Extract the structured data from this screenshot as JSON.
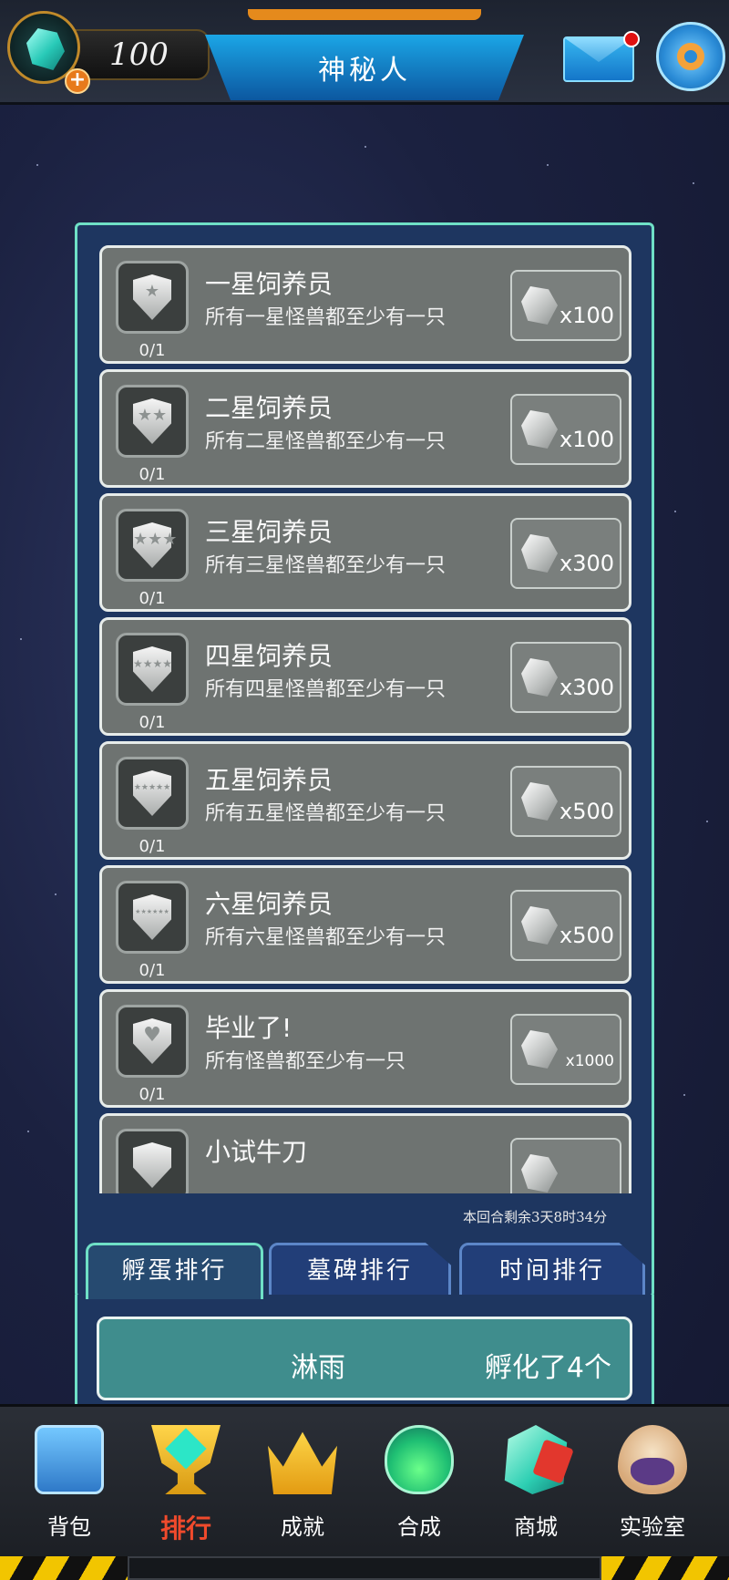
{
  "header": {
    "gem_count": "100",
    "title": "神秘人"
  },
  "achievements": [
    {
      "title": "一星饲养员",
      "desc": "所有一星怪兽都至少有一只",
      "progress": "0/1",
      "reward": "x100",
      "stars": "★"
    },
    {
      "title": "二星饲养员",
      "desc": "所有二星怪兽都至少有一只",
      "progress": "0/1",
      "reward": "x100",
      "stars": "★★"
    },
    {
      "title": "三星饲养员",
      "desc": "所有三星怪兽都至少有一只",
      "progress": "0/1",
      "reward": "x300",
      "stars": "★★★"
    },
    {
      "title": "四星饲养员",
      "desc": "所有四星怪兽都至少有一只",
      "progress": "0/1",
      "reward": "x300",
      "stars": "★★★★"
    },
    {
      "title": "五星饲养员",
      "desc": "所有五星怪兽都至少有一只",
      "progress": "0/1",
      "reward": "x500",
      "stars": "★★★★★"
    },
    {
      "title": "六星饲养员",
      "desc": "所有六星怪兽都至少有一只",
      "progress": "0/1",
      "reward": "x500",
      "stars": "★★★★★★"
    },
    {
      "title": "毕业了!",
      "desc": "所有怪兽都至少有一只",
      "progress": "0/1",
      "reward": "x1000",
      "stars": "♥"
    },
    {
      "title": "小试牛刀",
      "desc": "",
      "progress": "",
      "reward": "",
      "stars": ""
    }
  ],
  "countdown": "本回合剩余3天8时34分",
  "tabs": [
    "孵蛋排行",
    "墓碑排行",
    "时间排行"
  ],
  "ranking": {
    "name": "淋雨",
    "result": "孵化了4个"
  },
  "bottom_nav": [
    {
      "label": "背包",
      "icon": "backpack-icon"
    },
    {
      "label": "排行",
      "icon": "trophy-icon"
    },
    {
      "label": "成就",
      "icon": "crown-icon"
    },
    {
      "label": "合成",
      "icon": "flask-icon"
    },
    {
      "label": "商城",
      "icon": "shop-gem-icon"
    },
    {
      "label": "实验室",
      "icon": "egg-lab-icon"
    }
  ],
  "colors": {
    "accent": "#6fe0c6",
    "active_nav": "#f04a2c",
    "card_bg": "#6e7371",
    "ranking_bg": "#3f8d8d"
  }
}
